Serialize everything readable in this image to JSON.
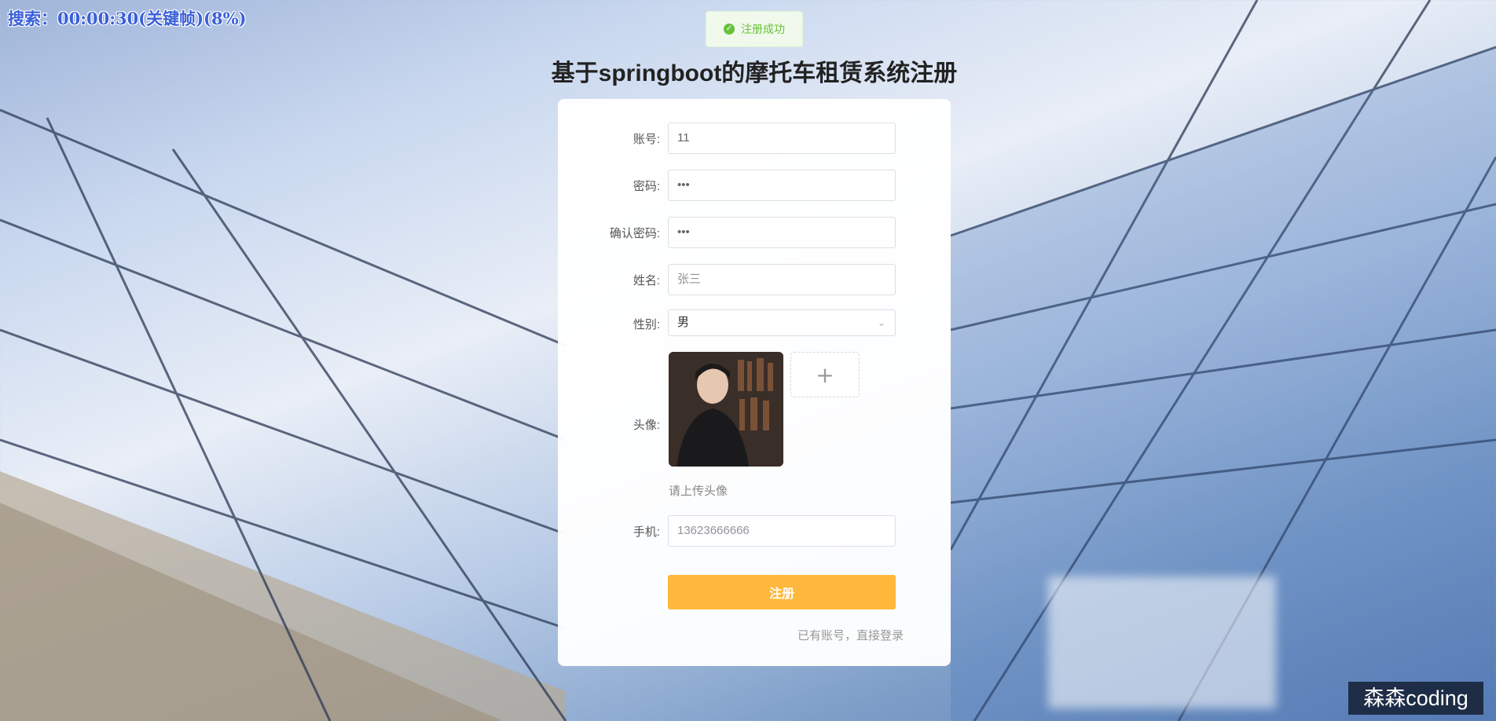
{
  "overlay": {
    "timer": "搜索：00:00:30(关键帧)(8%)"
  },
  "toast": {
    "text": "注册成功"
  },
  "page": {
    "title": "基于springboot的摩托车租赁系统注册"
  },
  "form": {
    "account_label": "账号:",
    "account_value": "11",
    "password_label": "密码:",
    "password_value": "•••",
    "confirm_label": "确认密码:",
    "confirm_value": "•••",
    "name_label": "姓名:",
    "name_placeholder": "张三",
    "gender_label": "性别:",
    "gender_value": "男",
    "avatar_label": "头像:",
    "avatar_hint": "请上传头像",
    "upload_plus": "+",
    "phone_label": "手机:",
    "phone_placeholder": "13623666666",
    "submit_label": "注册",
    "login_link": "已有账号，直接登录"
  },
  "brand": {
    "text": "森森coding"
  },
  "colors": {
    "accent": "#ffb83b",
    "success": "#67c23a"
  }
}
